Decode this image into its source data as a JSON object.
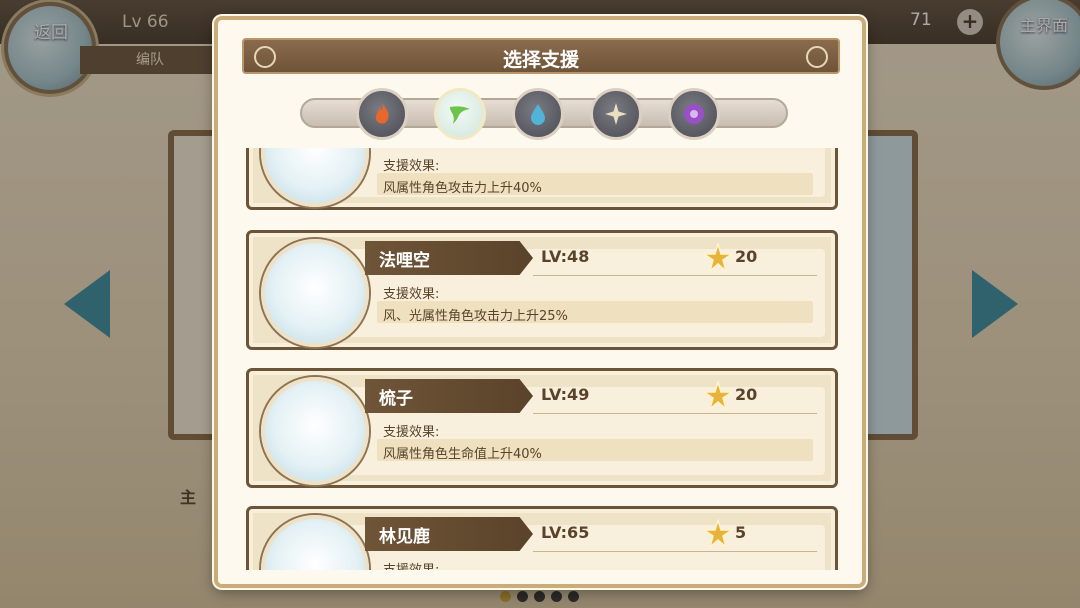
{
  "header": {
    "back_label": "返回",
    "level": "Lv 66",
    "formation_tab": "编队",
    "gem_count": "71",
    "main_label": "主界面"
  },
  "background": {
    "main_label": "主",
    "page_dots": 5,
    "active_dot": 0
  },
  "dialog": {
    "title": "选择支援",
    "element_tabs": [
      {
        "name": "fire",
        "icon": "fire-icon",
        "active": false
      },
      {
        "name": "wind",
        "icon": "wind-icon",
        "active": true
      },
      {
        "name": "water",
        "icon": "water-drop-icon",
        "active": false
      },
      {
        "name": "light",
        "icon": "light-star-icon",
        "active": false
      },
      {
        "name": "dark",
        "icon": "dark-orb-icon",
        "active": false
      }
    ],
    "partial_top": {
      "effect_label": "支援效果:",
      "effect": "风属性角色攻击力上升40%"
    },
    "supports": [
      {
        "name": "法哩空",
        "level": "LV:48",
        "cost": "20",
        "effect_label": "支援效果:",
        "effect": "风、光属性角色攻击力上升25%"
      },
      {
        "name": "梳子",
        "level": "LV:49",
        "cost": "20",
        "effect_label": "支援效果:",
        "effect": "风属性角色生命值上升40%"
      },
      {
        "name": "林见鹿",
        "level": "LV:65",
        "cost": "5",
        "effect_label": "支援效果:",
        "effect": ""
      }
    ]
  },
  "colors": {
    "accent_brown": "#6f5538",
    "teal": "#3f8fa4",
    "gold": "#e8b33a"
  }
}
